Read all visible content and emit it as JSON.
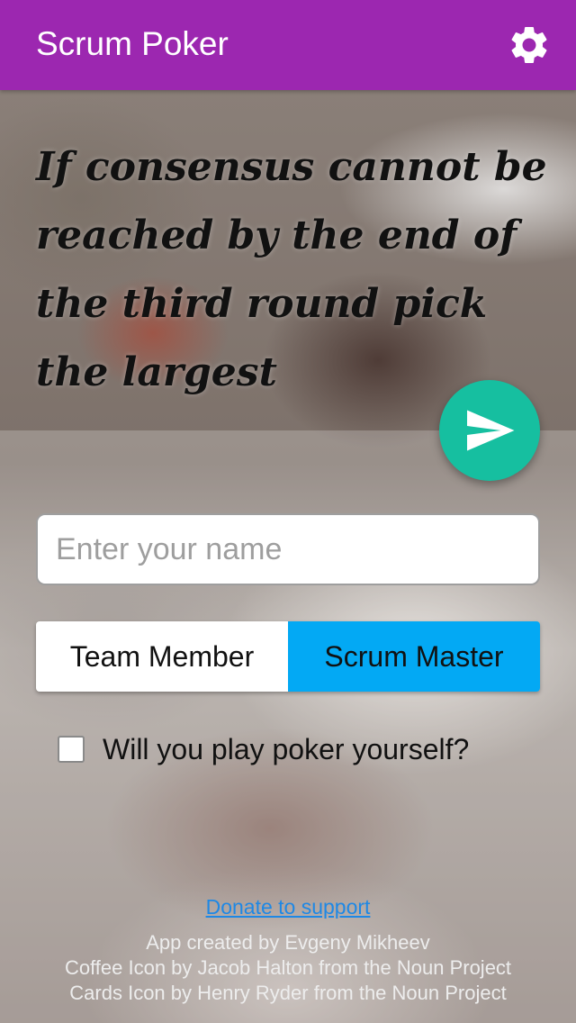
{
  "app_bar": {
    "title": "Scrum Poker",
    "settings_icon": "gear-icon",
    "background": "#9c27b0"
  },
  "quote": {
    "text": "If consensus cannot be reached by the end of the third round pick the largest"
  },
  "send_button": {
    "icon": "send-icon",
    "color": "#16bfa0"
  },
  "name_field": {
    "value": "",
    "placeholder": "Enter your name"
  },
  "role_toggle": {
    "member_label": "Team Member",
    "master_label": "Scrum Master",
    "selected": "Scrum Master",
    "selected_color": "#03a9f4"
  },
  "play_checkbox": {
    "label": "Will you play poker yourself?",
    "checked": false
  },
  "footer": {
    "donate_label": "Donate to support",
    "credits": [
      "App created by Evgeny Mikheev",
      "Coffee Icon by Jacob Halton from the Noun Project",
      "Cards Icon by Henry Ryder from the Noun Project"
    ]
  }
}
